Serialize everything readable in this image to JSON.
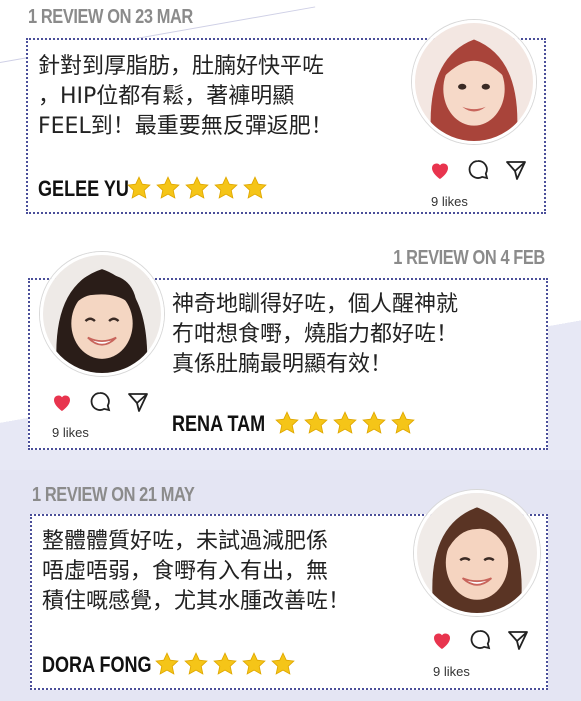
{
  "reviews": [
    {
      "heading": "1 REVIEW ON 23 MAR",
      "quote": "針對到厚脂肪，肚腩好快平咗\n，HIP位都有鬆，著褲明顯\nFEEL到！最重要無反彈返肥！",
      "name": "GELEE YU",
      "likes": "9 likes",
      "rating": 5
    },
    {
      "heading": "1 REVIEW ON 4 FEB",
      "quote": "神奇地瞓得好咗，個人醒神就\n冇咁想食嘢，燒脂力都好咗！\n真係肚腩最明顯有效！",
      "name": "RENA TAM",
      "likes": "9 likes",
      "rating": 5
    },
    {
      "heading": "1 REVIEW ON 21 MAY",
      "quote": "整體體質好咗，未試過減肥係\n唔虛唔弱，食嘢有入有出，無\n積住嘅感覺，尤其水腫改善咗！",
      "name": "DORA FONG",
      "likes": "9 likes",
      "rating": 5
    }
  ],
  "colors": {
    "heading": "#8b8b8b",
    "border": "#4b4f9a",
    "star": "#f5c518",
    "heart": "#e8344e",
    "band": "#e4e5f3"
  },
  "icons": [
    "heart-icon",
    "comment-icon",
    "share-icon",
    "star-icon"
  ]
}
